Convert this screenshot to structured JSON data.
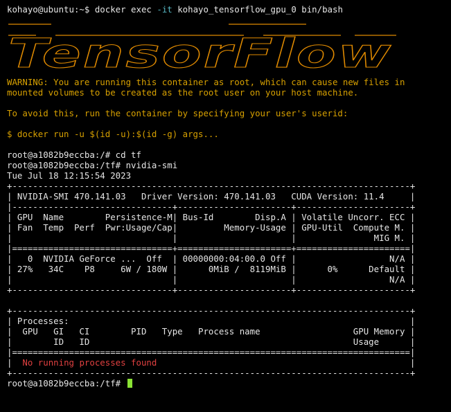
{
  "colors": {
    "background": "#000000",
    "foreground": "#e6e6e6",
    "warning": "#d7a000",
    "banner": "#e08a00",
    "error": "#e04040",
    "option": "#56b6c2",
    "cursor": "#8ae234"
  },
  "host_prompt": {
    "user_host": "kohayo@ubuntu:~$ ",
    "cmd_a": "docker exec ",
    "cmd_flag": "-it",
    "cmd_b": " kohayo_tensorflow_gpu_0 bin/bash"
  },
  "banner_logo": {
    "text": "TensorFlow"
  },
  "warning": {
    "line1": "WARNING: You are running this container as root, which can cause new files in",
    "line2": "mounted volumes to be created as the root user on your host machine.",
    "line3": "To avoid this, run the container by specifying your user's userid:",
    "line4": "$ docker run -u $(id -u):$(id -g) args..."
  },
  "session": {
    "prompt1": "root@a1082b9eccba:/# cd tf",
    "prompt2": "root@a1082b9eccba:/tf# nvidia-smi",
    "datetime": "Tue Jul 18 12:15:54 2023"
  },
  "smi": {
    "l01": "+-----------------------------------------------------------------------------+",
    "l02": "| NVIDIA-SMI 470.141.03   Driver Version: 470.141.03   CUDA Version: 11.4     |",
    "l03": "|-------------------------------+----------------------+----------------------+",
    "l04": "| GPU  Name        Persistence-M| Bus-Id        Disp.A | Volatile Uncorr. ECC |",
    "l05": "| Fan  Temp  Perf  Pwr:Usage/Cap|         Memory-Usage | GPU-Util  Compute M. |",
    "l06": "|                               |                      |               MIG M. |",
    "l07": "|===============================+======================+======================|",
    "l08": "|   0  NVIDIA GeForce ...  Off  | 00000000:04:00.0 Off |                  N/A |",
    "l09": "| 27%   34C    P8     6W / 180W |      0MiB /  8119MiB |      0%      Default |",
    "l10": "|                               |                      |                  N/A |",
    "l11": "+-------------------------------+----------------------+----------------------+",
    "l12": "",
    "l13": "+-----------------------------------------------------------------------------+",
    "l14": "| Processes:                                                                  |",
    "l15": "|  GPU   GI   CI        PID   Type   Process name                  GPU Memory |",
    "l16": "|        ID   ID                                                   Usage      |",
    "l17": "|=============================================================================|",
    "l18_a": "|  ",
    "l18_msg": "No running processes found",
    "l18_b": "                                                 |",
    "l19": "+-----------------------------------------------------------------------------+"
  },
  "final_prompt": "root@a1082b9eccba:/tf# "
}
